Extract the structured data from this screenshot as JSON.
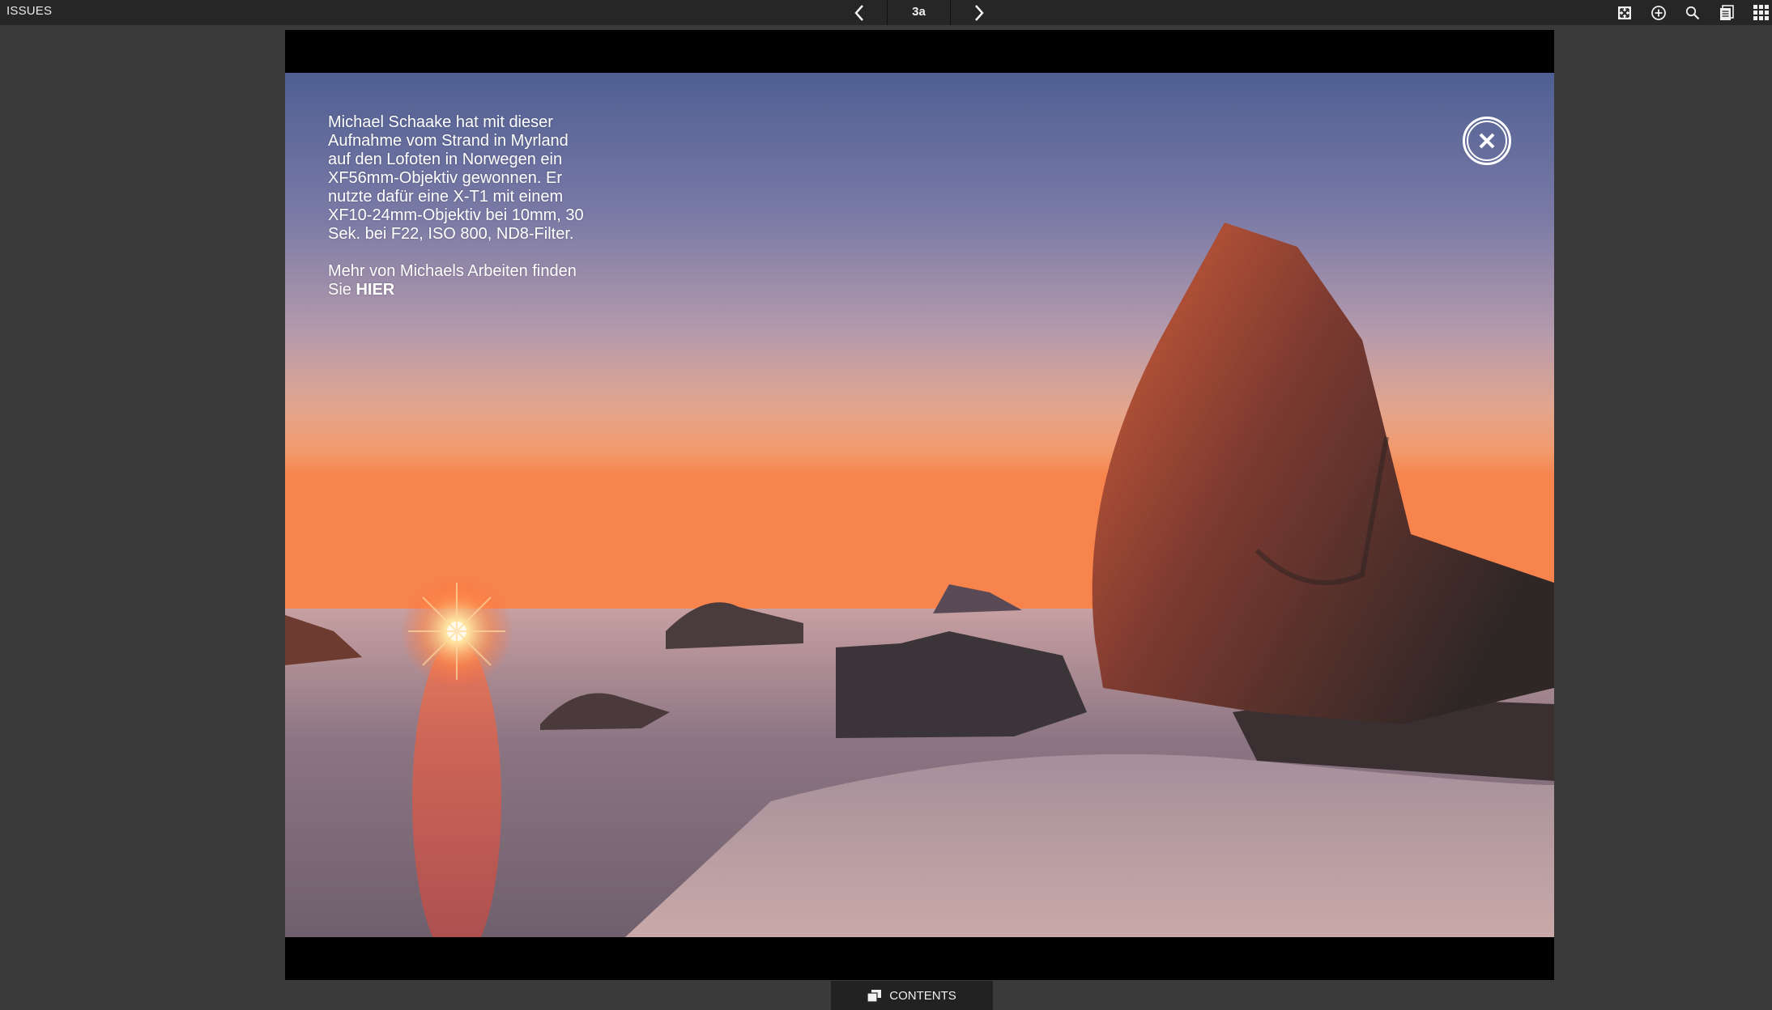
{
  "topbar": {
    "issues_label": "ISSUES",
    "page_number": "3a",
    "prev_icon": "chevron-left-icon",
    "next_icon": "chevron-right-icon",
    "tools": [
      "fullscreen-icon",
      "zoom-in-icon",
      "search-icon",
      "pages-icon",
      "grid-icon"
    ]
  },
  "caption": {
    "paragraph1": "Michael Schaake hat mit dieser Aufnahme vom Strand in Myrland auf den Lofoten in Norwegen ein XF56mm-Objektiv gewonnen. Er nutzte dafür eine X-T1 mit einem XF10-24mm-Objektiv bei 10mm, 30 Sek. bei F22, ISO 800, ND8-Filter.",
    "paragraph2_prefix": "Mehr von Michaels Arbeiten finden Sie ",
    "paragraph2_link": "HIER"
  },
  "overlay": {
    "close_icon": "close-circle-icon"
  },
  "footer": {
    "contents_label": "CONTENTS",
    "contents_icon": "contents-icon"
  },
  "colors": {
    "topbar_bg": "#262626",
    "viewer_bg": "#3a3a3a",
    "page_bg": "#000000"
  }
}
